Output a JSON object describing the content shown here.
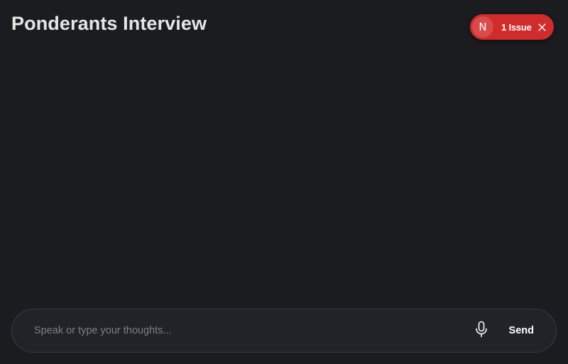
{
  "header": {
    "title": "Ponderants Interview"
  },
  "issue_indicator": {
    "badge_letter": "N",
    "label": "1 Issue",
    "color": "#d02c2c"
  },
  "composer": {
    "placeholder": "Speak or type your thoughts...",
    "value": "",
    "mic_icon": "microphone-icon",
    "send_label": "Send"
  },
  "theme": {
    "background": "#1b1c20",
    "input_background": "#222328"
  }
}
